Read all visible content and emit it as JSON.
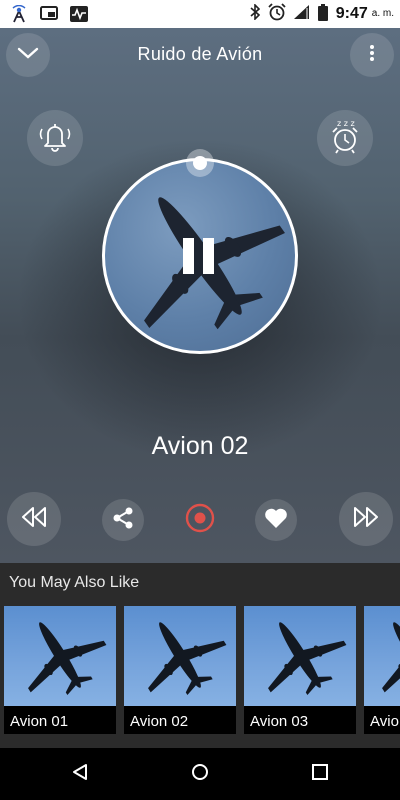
{
  "status_bar": {
    "time": "9:47",
    "ampm": "a. m."
  },
  "header": {
    "title": "Ruido de Avión"
  },
  "player": {
    "track_title": "Avion 02",
    "playback_state": "playing",
    "progress_fraction": 0.0
  },
  "recommendations": {
    "title": "You May Also Like",
    "items": [
      {
        "label": "Avion 01"
      },
      {
        "label": "Avion 02"
      },
      {
        "label": "Avion 03"
      },
      {
        "label": "Avio"
      }
    ]
  },
  "colors": {
    "record_accent": "#e0514a",
    "card_sky": "#6f9fd8",
    "section_bg": "#2b2b2b"
  },
  "icons": {
    "collapse": "chevron-down-icon",
    "menu": "more-vert-icon",
    "alarm": "bell-icon",
    "sleep_timer": "alarm-clock-zzz-icon",
    "pause": "pause-icon",
    "rewind": "rewind-icon",
    "share": "share-icon",
    "record": "record-icon",
    "favorite": "heart-icon",
    "forward": "fast-forward-icon"
  }
}
